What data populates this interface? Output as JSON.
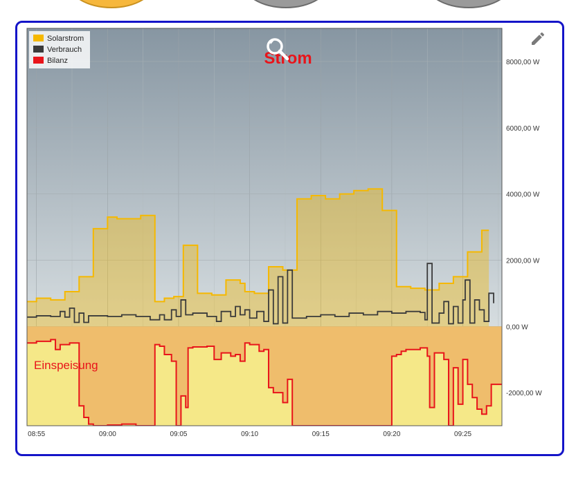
{
  "chart_data": {
    "type": "line",
    "title": "Strom",
    "xlabel": "",
    "ylabel": "",
    "y_unit": "W",
    "x_ticks": [
      "08:55",
      "09:00",
      "09:05",
      "09:10",
      "09:15",
      "09:20",
      "09:25"
    ],
    "y_ticks": [
      "8000,00 W",
      "6000,00 W",
      "4000,00 W",
      "2000,00 W",
      "0,00 W",
      "-2000,00 W"
    ],
    "y_tick_values": [
      8000,
      6000,
      4000,
      2000,
      0,
      -2000
    ],
    "ylim": [
      -3000,
      9000
    ],
    "xlim": [
      "08:54:20",
      "09:27:45"
    ],
    "grid": true,
    "legend_position": "top-left",
    "annotation": "Einspeisung",
    "step": true,
    "series": [
      {
        "name": "Solarstrom",
        "color": "#f5b800",
        "fill": true,
        "points": [
          [
            "08:54:20",
            750
          ],
          [
            "08:55:00",
            850
          ],
          [
            "08:56:00",
            800
          ],
          [
            "08:57:00",
            1050
          ],
          [
            "08:58:00",
            1500
          ],
          [
            "08:59:00",
            2950
          ],
          [
            "09:00:00",
            3300
          ],
          [
            "09:00:40",
            3250
          ],
          [
            "09:02:20",
            3350
          ],
          [
            "09:03:20",
            750
          ],
          [
            "09:04:00",
            850
          ],
          [
            "09:04:40",
            900
          ],
          [
            "09:05:20",
            2450
          ],
          [
            "09:06:20",
            1000
          ],
          [
            "09:07:20",
            950
          ],
          [
            "09:08:20",
            1400
          ],
          [
            "09:09:20",
            1300
          ],
          [
            "09:09:40",
            1050
          ],
          [
            "09:10:20",
            1000
          ],
          [
            "09:11:20",
            1800
          ],
          [
            "09:12:20",
            1700
          ],
          [
            "09:13:20",
            3850
          ],
          [
            "09:14:20",
            3950
          ],
          [
            "09:15:20",
            3850
          ],
          [
            "09:16:20",
            4000
          ],
          [
            "09:17:20",
            4100
          ],
          [
            "09:18:20",
            4150
          ],
          [
            "09:19:20",
            3500
          ],
          [
            "09:20:20",
            1200
          ],
          [
            "09:21:20",
            1150
          ],
          [
            "09:22:20",
            1100
          ],
          [
            "09:23:20",
            1300
          ],
          [
            "09:24:20",
            1500
          ],
          [
            "09:25:20",
            2250
          ],
          [
            "09:26:20",
            2900
          ]
        ]
      },
      {
        "name": "Verbrauch",
        "color": "#3a3a3a",
        "fill": false,
        "points": [
          [
            "08:54:20",
            280
          ],
          [
            "08:55:00",
            320
          ],
          [
            "08:56:00",
            300
          ],
          [
            "08:56:40",
            450
          ],
          [
            "08:57:00",
            280
          ],
          [
            "08:57:20",
            550
          ],
          [
            "08:57:40",
            120
          ],
          [
            "08:58:00",
            400
          ],
          [
            "08:58:20",
            120
          ],
          [
            "08:58:40",
            320
          ],
          [
            "09:00:00",
            300
          ],
          [
            "09:01:00",
            350
          ],
          [
            "09:02:00",
            300
          ],
          [
            "09:03:00",
            200
          ],
          [
            "09:03:40",
            350
          ],
          [
            "09:04:00",
            200
          ],
          [
            "09:04:30",
            500
          ],
          [
            "09:04:50",
            300
          ],
          [
            "09:05:10",
            800
          ],
          [
            "09:05:30",
            350
          ],
          [
            "09:06:00",
            400
          ],
          [
            "09:07:00",
            300
          ],
          [
            "09:07:40",
            150
          ],
          [
            "09:08:00",
            450
          ],
          [
            "09:08:40",
            300
          ],
          [
            "09:09:00",
            600
          ],
          [
            "09:09:20",
            350
          ],
          [
            "09:09:40",
            500
          ],
          [
            "09:10:00",
            250
          ],
          [
            "09:10:30",
            450
          ],
          [
            "09:11:00",
            150
          ],
          [
            "09:11:20",
            1100
          ],
          [
            "09:11:40",
            80
          ],
          [
            "09:12:00",
            1500
          ],
          [
            "09:12:20",
            100
          ],
          [
            "09:12:40",
            1700
          ],
          [
            "09:13:00",
            250
          ],
          [
            "09:14:00",
            300
          ],
          [
            "09:15:00",
            350
          ],
          [
            "09:16:00",
            300
          ],
          [
            "09:17:00",
            400
          ],
          [
            "09:18:00",
            350
          ],
          [
            "09:19:00",
            450
          ],
          [
            "09:20:00",
            400
          ],
          [
            "09:21:00",
            450
          ],
          [
            "09:22:00",
            420
          ],
          [
            "09:22:20",
            200
          ],
          [
            "09:22:30",
            1900
          ],
          [
            "09:22:50",
            100
          ],
          [
            "09:23:20",
            400
          ],
          [
            "09:23:40",
            750
          ],
          [
            "09:24:00",
            80
          ],
          [
            "09:24:20",
            600
          ],
          [
            "09:24:40",
            100
          ],
          [
            "09:25:00",
            800
          ],
          [
            "09:25:10",
            1400
          ],
          [
            "09:25:30",
            100
          ],
          [
            "09:25:50",
            800
          ],
          [
            "09:26:10",
            500
          ],
          [
            "09:26:30",
            150
          ],
          [
            "09:26:50",
            1000
          ],
          [
            "09:27:10",
            700
          ]
        ]
      },
      {
        "name": "Bilanz",
        "color": "#e8141a",
        "fill": true,
        "fill_label_color": "#f5ec8c",
        "points": [
          [
            "08:54:20",
            -500
          ],
          [
            "08:55:00",
            -450
          ],
          [
            "08:56:00",
            -400
          ],
          [
            "08:56:20",
            -700
          ],
          [
            "08:56:40",
            -550
          ],
          [
            "08:57:20",
            -500
          ],
          [
            "08:58:00",
            -2400
          ],
          [
            "08:58:20",
            -2750
          ],
          [
            "08:58:40",
            -2950
          ],
          [
            "08:59:00",
            -3000
          ],
          [
            "09:00:00",
            -2980
          ],
          [
            "09:01:00",
            -2950
          ],
          [
            "09:02:00",
            -3000
          ],
          [
            "09:03:20",
            -550
          ],
          [
            "09:03:40",
            -600
          ],
          [
            "09:04:00",
            -850
          ],
          [
            "09:04:30",
            -1050
          ],
          [
            "09:04:50",
            -3000
          ],
          [
            "09:05:10",
            -2100
          ],
          [
            "09:05:30",
            -2450
          ],
          [
            "09:05:40",
            -650
          ],
          [
            "09:06:00",
            -620
          ],
          [
            "09:07:00",
            -600
          ],
          [
            "09:07:30",
            -1000
          ],
          [
            "09:08:00",
            -800
          ],
          [
            "09:08:40",
            -900
          ],
          [
            "09:09:00",
            -850
          ],
          [
            "09:09:20",
            -1050
          ],
          [
            "09:09:40",
            -500
          ],
          [
            "09:10:00",
            -550
          ],
          [
            "09:10:40",
            -750
          ],
          [
            "09:11:00",
            -700
          ],
          [
            "09:11:20",
            -1850
          ],
          [
            "09:11:40",
            -2000
          ],
          [
            "09:12:20",
            -2300
          ],
          [
            "09:12:40",
            -1600
          ],
          [
            "09:13:00",
            -3000
          ],
          [
            "09:20:00",
            -900
          ],
          [
            "09:20:20",
            -850
          ],
          [
            "09:20:40",
            -750
          ],
          [
            "09:21:00",
            -700
          ],
          [
            "09:22:00",
            -650
          ],
          [
            "09:22:30",
            -900
          ],
          [
            "09:22:40",
            -2450
          ],
          [
            "09:23:00",
            -800
          ],
          [
            "09:23:40",
            -1000
          ],
          [
            "09:24:00",
            -3000
          ],
          [
            "09:24:20",
            -1250
          ],
          [
            "09:24:40",
            -2350
          ],
          [
            "09:25:00",
            -1000
          ],
          [
            "09:25:20",
            -1750
          ],
          [
            "09:25:40",
            -2150
          ],
          [
            "09:26:00",
            -2500
          ],
          [
            "09:26:20",
            -2650
          ],
          [
            "09:26:40",
            -2400
          ],
          [
            "09:27:00",
            -1750
          ]
        ]
      }
    ]
  }
}
